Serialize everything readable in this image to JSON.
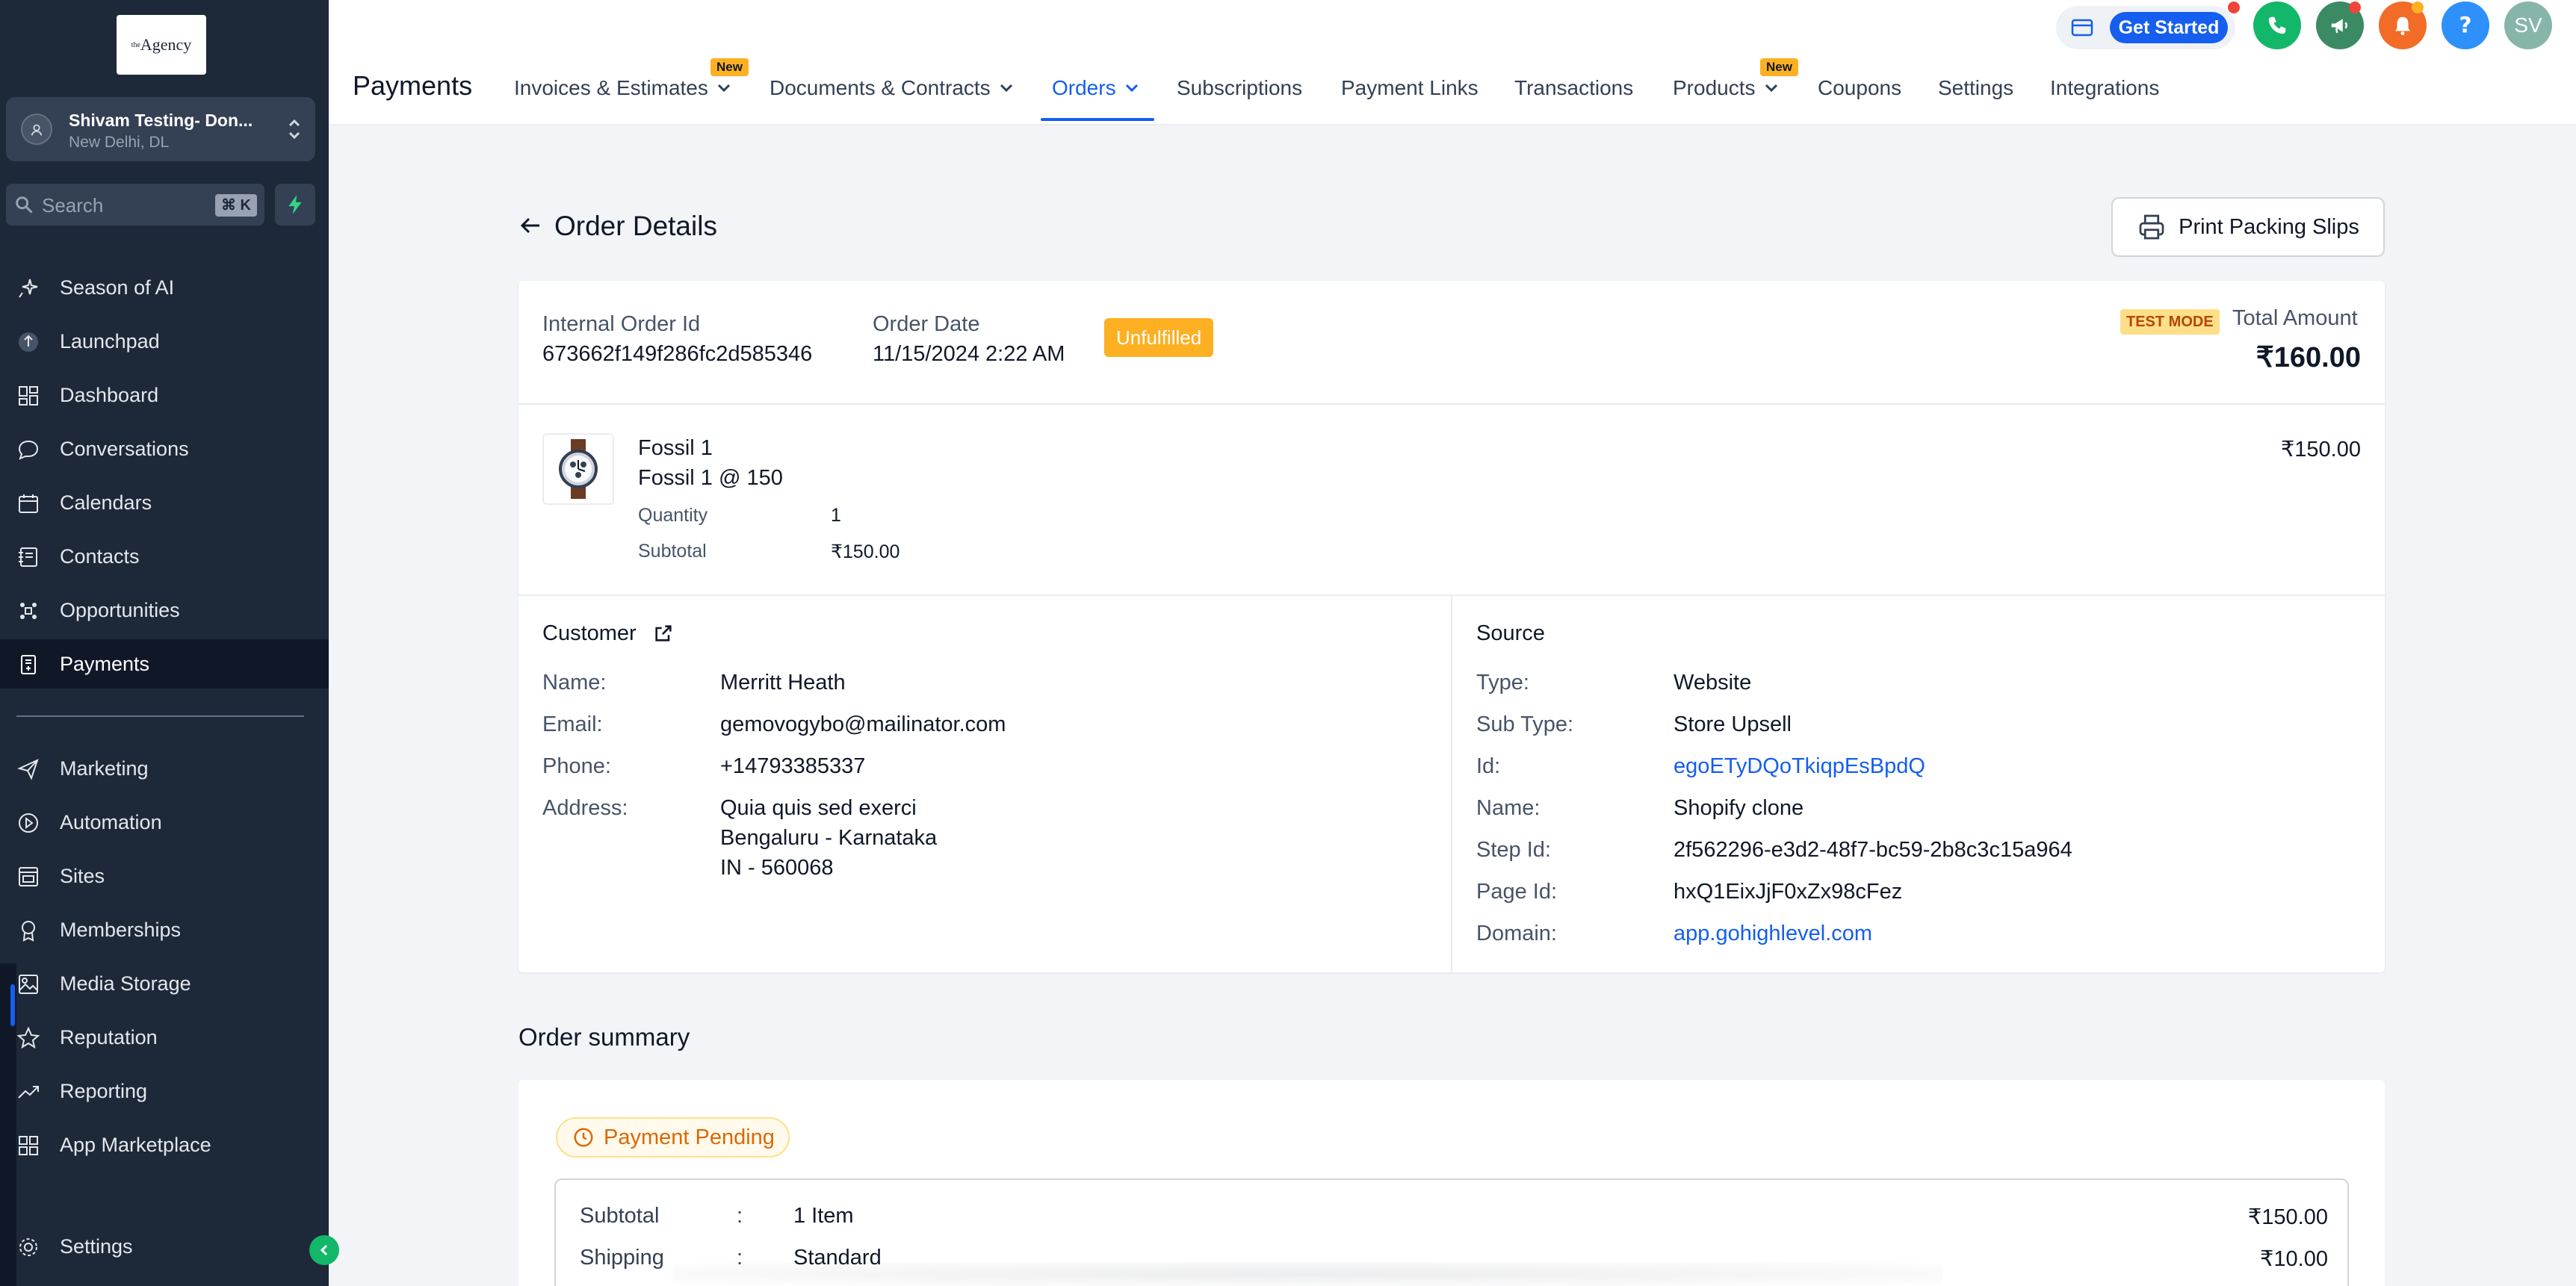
{
  "sidebar": {
    "logo_text": "Agency",
    "logo_sup": "the",
    "account_name": "Shivam Testing- Don...",
    "account_location": "New Delhi, DL",
    "search_placeholder": "Search",
    "search_shortcut": "⌘ K",
    "items_top": [
      {
        "label": "Season of AI",
        "icon": "sparkle-icon"
      },
      {
        "label": "Launchpad",
        "icon": "rocket-icon"
      },
      {
        "label": "Dashboard",
        "icon": "grid-icon"
      },
      {
        "label": "Conversations",
        "icon": "chat-icon"
      },
      {
        "label": "Calendars",
        "icon": "calendar-icon"
      },
      {
        "label": "Contacts",
        "icon": "contacts-icon"
      },
      {
        "label": "Opportunities",
        "icon": "opportunities-icon"
      },
      {
        "label": "Payments",
        "icon": "payments-icon"
      }
    ],
    "items_bottom": [
      {
        "label": "Marketing",
        "icon": "send-icon"
      },
      {
        "label": "Automation",
        "icon": "automation-icon"
      },
      {
        "label": "Sites",
        "icon": "sites-icon"
      },
      {
        "label": "Memberships",
        "icon": "membership-icon"
      },
      {
        "label": "Media Storage",
        "icon": "image-icon"
      },
      {
        "label": "Reputation",
        "icon": "star-icon"
      },
      {
        "label": "Reporting",
        "icon": "chart-icon"
      },
      {
        "label": "App Marketplace",
        "icon": "apps-icon"
      }
    ],
    "settings_label": "Settings"
  },
  "header": {
    "title": "Payments",
    "tabs": [
      {
        "label": "Invoices & Estimates"
      },
      {
        "label": "Documents & Contracts"
      },
      {
        "label": "Orders"
      },
      {
        "label": "Subscriptions"
      },
      {
        "label": "Payment Links"
      },
      {
        "label": "Transactions"
      },
      {
        "label": "Products"
      },
      {
        "label": "Coupons"
      },
      {
        "label": "Settings"
      },
      {
        "label": "Integrations"
      }
    ],
    "new_badge": "New",
    "get_started": "Get Started",
    "user_initials": "SV"
  },
  "order": {
    "title": "Order Details",
    "print_button": "Print Packing Slips",
    "internal_id_label": "Internal Order Id",
    "internal_id": "673662f149f286fc2d585346",
    "order_date_label": "Order Date",
    "order_date": "11/15/2024 2:22 AM",
    "status": "Unfulfilled",
    "test_mode": "TEST MODE",
    "total_label": "Total Amount",
    "total": "₹160.00",
    "item": {
      "name": "Fossil 1",
      "variant": "Fossil 1 @ 150",
      "price": "₹150.00",
      "quantity_label": "Quantity",
      "quantity": "1",
      "subtotal_label": "Subtotal",
      "subtotal": "₹150.00"
    },
    "customer": {
      "heading": "Customer",
      "name_label": "Name:",
      "name": "Merritt Heath",
      "email_label": "Email:",
      "email": "gemovogybo@mailinator.com",
      "phone_label": "Phone:",
      "phone": "+14793385337",
      "address_label": "Address:",
      "address_line1": "Quia quis sed exerci",
      "address_line2": "Bengaluru - Karnataka",
      "address_line3": "IN - 560068"
    },
    "source": {
      "heading": "Source",
      "type_label": "Type:",
      "type": "Website",
      "subtype_label": "Sub Type:",
      "subtype": "Store Upsell",
      "id_label": "Id:",
      "id": "egoETyDQoTkiqpEsBpdQ",
      "name_label": "Name:",
      "name": "Shopify clone",
      "step_label": "Step Id:",
      "step_id": "2f562296-e3d2-48f7-bc59-2b8c3c15a964",
      "page_label": "Page Id:",
      "page_id": "hxQ1EixJjF0xZx98cFez",
      "domain_label": "Domain:",
      "domain": "app.gohighlevel.com"
    }
  },
  "summary": {
    "title": "Order summary",
    "payment_status": "Payment Pending",
    "rows": [
      {
        "key": "Subtotal",
        "colon": ":",
        "mid": "1 Item",
        "amount": "₹150.00"
      },
      {
        "key": "Shipping",
        "colon": ":",
        "mid": "Standard",
        "amount": "₹10.00"
      }
    ]
  },
  "colors": {
    "sidebar_bg": "#1d2939",
    "accent": "#155eef",
    "status_warning": "#fdb022",
    "link": "#155eef"
  }
}
